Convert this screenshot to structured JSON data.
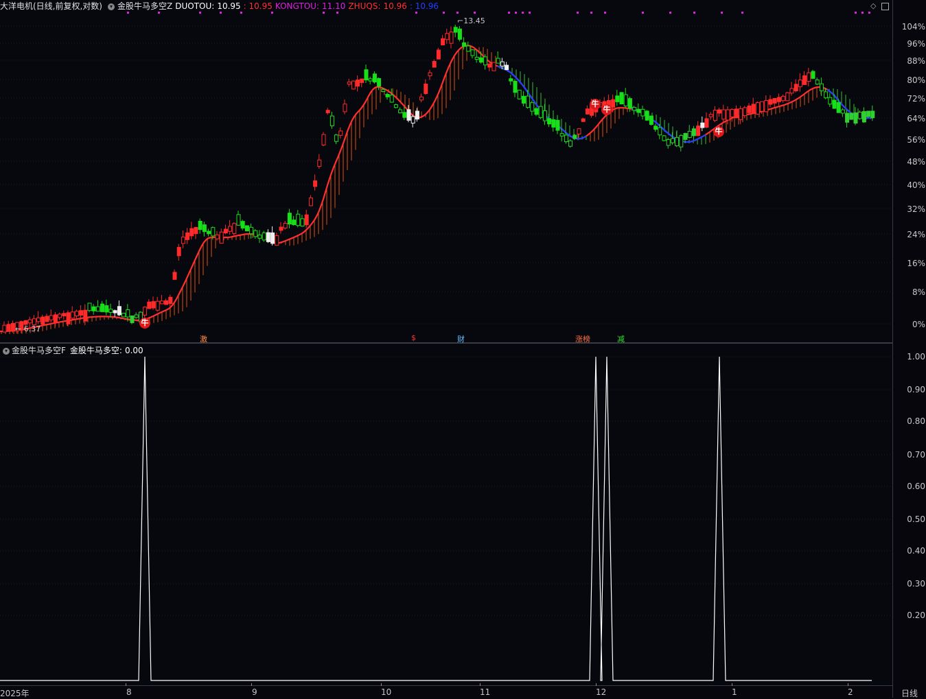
{
  "header": {
    "stock_title": "大洋电机(日线,前复权,对数)",
    "indicator_name": "金股牛马多空Z",
    "duotou_label": "DUOTOU:",
    "duotou_value": "10.95",
    "duotou_second": ": 10.95",
    "kongtou_label": "KONGTOU:",
    "kongtou_value": "11.10",
    "zhuqs_label": "ZHUQS:",
    "zhuqs_value": "10.96",
    "zhuqs_second": ": 10.96"
  },
  "sub_header": {
    "indicator_name": "金股牛马多空F",
    "value_label": "金股牛马多空:",
    "value": "0.00"
  },
  "price_annotations": {
    "high": "13.45",
    "low": "6.37"
  },
  "main_axis_ticks": [
    "104%",
    "96%",
    "88%",
    "80%",
    "72%",
    "64%",
    "56%",
    "48%",
    "40%",
    "32%",
    "24%",
    "16%",
    "8%",
    "0%"
  ],
  "sub_axis_ticks": [
    "1.00",
    "0.90",
    "0.80",
    "0.70",
    "0.60",
    "0.50",
    "0.40",
    "0.30",
    "0.20"
  ],
  "x_axis_labels": [
    "2025年",
    "8",
    "9",
    "10",
    "11",
    "12",
    "1",
    "2"
  ],
  "period_label": "日线",
  "event_tags": [
    "激",
    "$",
    "财",
    "涨榜",
    "减"
  ],
  "signal_marker": "牛",
  "colors": {
    "up": "#ff2a2a",
    "down": "#18e018",
    "neutral": "#f0f0f0",
    "duotou": "#ff3030",
    "kongtou": "#e020e0",
    "zhuqs": "#ff3030",
    "zhuqs_down": "#2040ff",
    "signal": "#ffffff"
  },
  "chart_data": [
    {
      "type": "candlestick",
      "title": "大洋电机(日线,前复权,对数)",
      "y_axis": "percent change, log scale",
      "ylim_percent": [
        0,
        104
      ],
      "price_high": 13.45,
      "price_low": 6.37,
      "series": [
        {
          "name": "DUOTOU",
          "last": 10.95
        },
        {
          "name": "KONGTOU",
          "last": 11.1
        },
        {
          "name": "ZHUQS",
          "last": 10.96
        }
      ]
    },
    {
      "type": "line",
      "title": "金股牛马多空F",
      "ylim": [
        0.15,
        1.03
      ],
      "baseline": 0,
      "spikes": [
        {
          "month": "8",
          "value": 1.0
        },
        {
          "month": "12",
          "value": 1.0
        },
        {
          "month": "12",
          "value": 1.0
        },
        {
          "month": "1",
          "value": 1.0
        }
      ],
      "current_value": 0.0
    }
  ]
}
